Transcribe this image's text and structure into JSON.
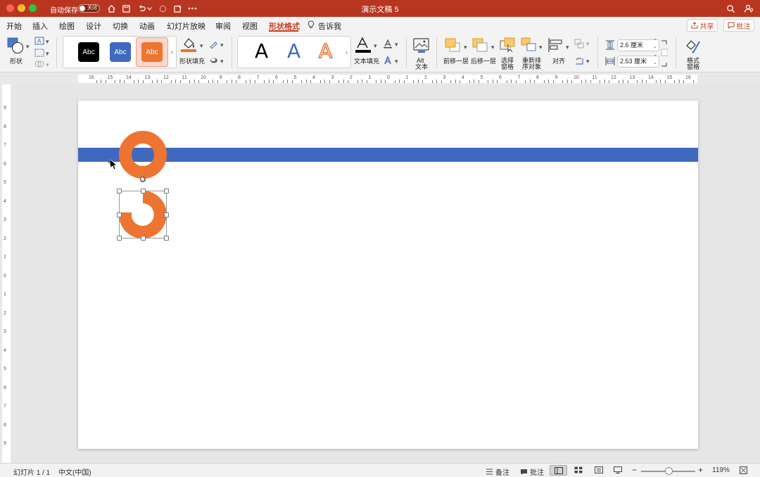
{
  "titlebar": {
    "autosave_label": "自动保存",
    "autosave_state": "关闭",
    "doc_title": "演示文稿 5"
  },
  "tabs": [
    {
      "label": "开始"
    },
    {
      "label": "插入"
    },
    {
      "label": "绘图"
    },
    {
      "label": "设计"
    },
    {
      "label": "切换"
    },
    {
      "label": "动画"
    },
    {
      "label": "幻灯片放映"
    },
    {
      "label": "审阅"
    },
    {
      "label": "视图"
    },
    {
      "label": "形状格式"
    },
    {
      "label": "告诉我"
    }
  ],
  "active_tab": "形状格式",
  "top_buttons": {
    "share": "共享",
    "comments": "批注"
  },
  "ribbon": {
    "shapes_label": "形状",
    "style_swatches": [
      {
        "label": "Abc",
        "color": "#000000"
      },
      {
        "label": "Abc",
        "color": "#4168bf"
      },
      {
        "label": "Abc",
        "color": "#ed7431"
      }
    ],
    "shape_fill_label": "形状填充",
    "shape_fill_color": "#ed7431",
    "wordart_letters": [
      {
        "label": "A",
        "color": "#000000"
      },
      {
        "label": "A",
        "color": "#4168bf"
      },
      {
        "label": "A",
        "color": "#ed7431"
      }
    ],
    "text_fill_label": "文本填充",
    "alt_text_label_1": "Alt",
    "alt_text_label_2": "文本",
    "bring_forward": "前移一层",
    "send_backward": "后移一层",
    "selection_pane_1": "选择",
    "selection_pane_2": "窗格",
    "reorder_1": "重新排",
    "reorder_2": "序对象",
    "align": "对齐",
    "height_value": "2.6 厘米",
    "width_value": "2.53 厘米",
    "format_pane_1": "格式",
    "format_pane_2": "窗格"
  },
  "ruler": {
    "h_numbers": [
      "16",
      "15",
      "14",
      "13",
      "12",
      "11",
      "10",
      "9",
      "8",
      "7",
      "6",
      "5",
      "4",
      "3",
      "2",
      "1",
      "0",
      "1",
      "2",
      "3",
      "4",
      "5",
      "6",
      "7",
      "8",
      "9",
      "10",
      "11",
      "12",
      "13",
      "14",
      "15",
      "16"
    ],
    "v_numbers": [
      "9",
      "8",
      "7",
      "6",
      "5",
      "4",
      "3",
      "2",
      "1",
      "0",
      "1",
      "2",
      "3",
      "4",
      "5",
      "6",
      "7",
      "8",
      "9"
    ]
  },
  "slide": {
    "band_color": "#4168bf",
    "ring_color": "#ed7431"
  },
  "statusbar": {
    "slide_info": "幻灯片 1 / 1",
    "language": "中文(中国)",
    "notes": "备注",
    "comments": "批注",
    "zoom": "119%"
  }
}
